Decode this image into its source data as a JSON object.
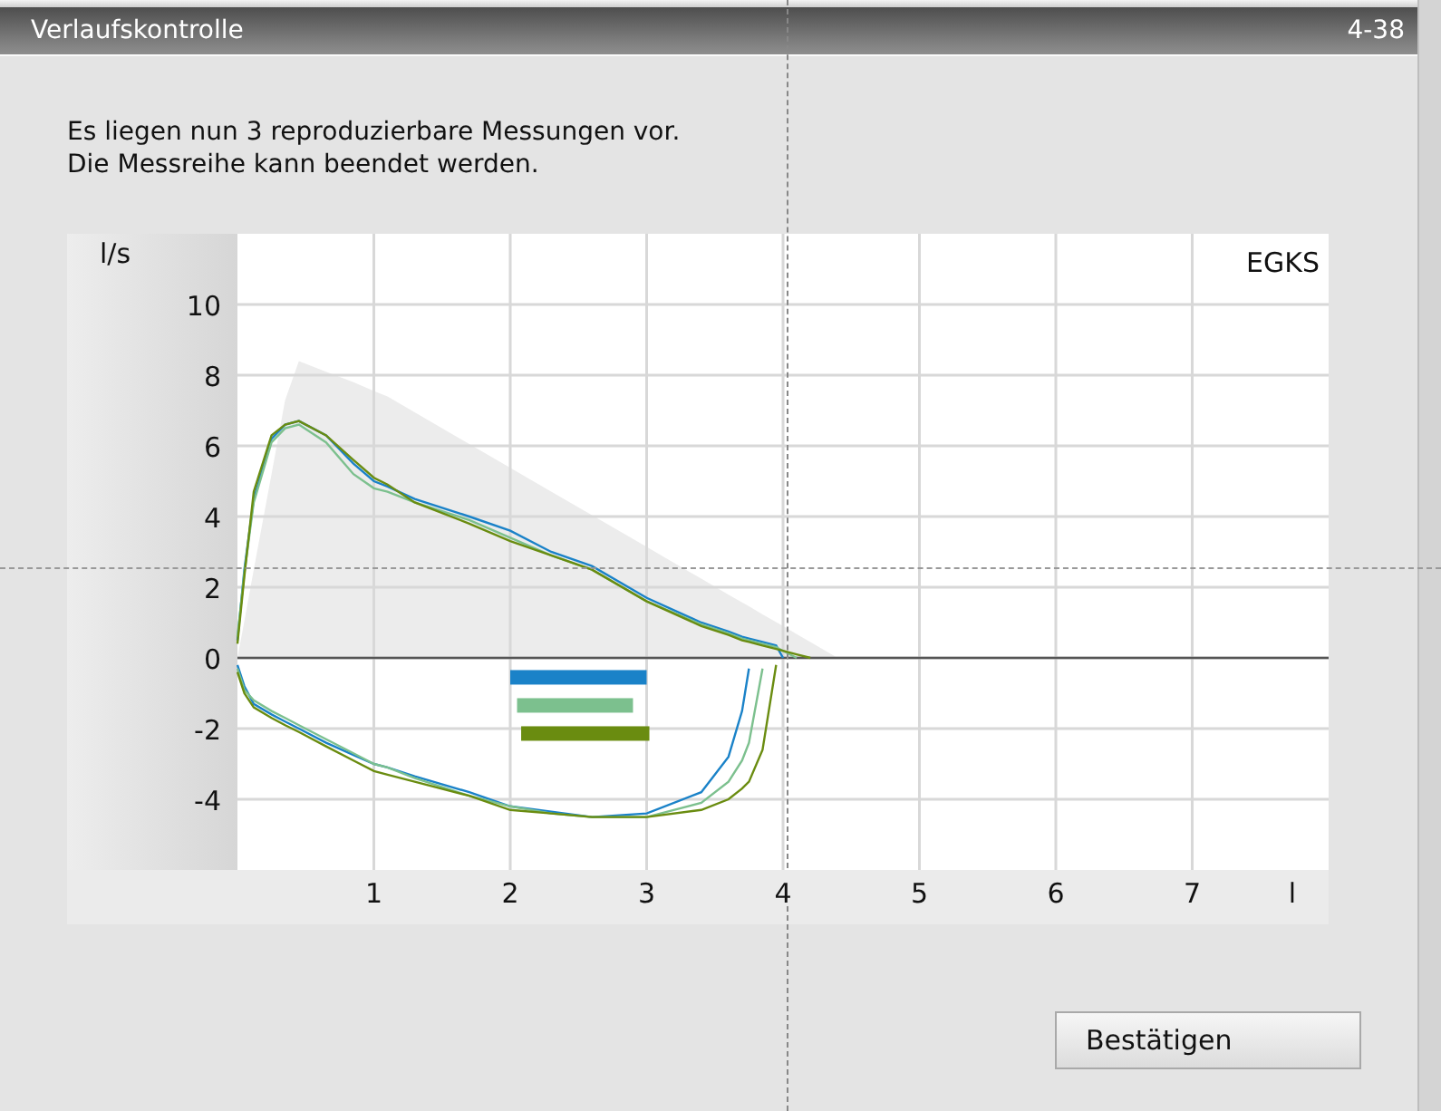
{
  "window": {
    "title": "Verlaufskontrolle",
    "code": "4-38"
  },
  "message": [
    "Es liegen nun 3 reproduzierbare Messungen vor.",
    "Die Messreihe kann beendet werden."
  ],
  "chart": {
    "chart_data": {
      "type": "line",
      "title": "EGKS",
      "xlabel": "l",
      "ylabel": "l/s",
      "xlim": [
        0,
        8
      ],
      "ylim": [
        -6,
        12
      ],
      "xticks": [
        1,
        2,
        3,
        4,
        5,
        6,
        7
      ],
      "yticks": [
        -4,
        -2,
        0,
        2,
        4,
        6,
        8,
        10
      ],
      "x": [
        0,
        0.05,
        0.12,
        0.25,
        0.35,
        0.45,
        0.65,
        0.85,
        1.0,
        1.1,
        1.3,
        1.7,
        2.0,
        2.3,
        2.6,
        3.0,
        3.4,
        3.6,
        3.7,
        3.75,
        3.85,
        3.95,
        4.0,
        4.1,
        4.2,
        4.4
      ],
      "series": [
        {
          "type": "area",
          "color": "#ececec",
          "values": [
            0,
            1.04,
            2.5,
            5.2,
            7.3,
            8.4,
            8.1,
            7.8,
            7.55,
            7.4,
            6.95,
            6.05,
            5.38,
            4.71,
            4.04,
            3.14,
            2.24,
            1.79,
            1.57,
            1.46,
            1.23,
            1.01,
            0.9,
            0.67,
            0.45,
            0
          ]
        },
        {
          "type": "line",
          "color": "#1a82c8",
          "values": [
            0.5,
            2.5,
            4.5,
            6.2,
            6.6,
            6.7,
            6.3,
            5.5,
            5.0,
            4.85,
            4.5,
            4.0,
            3.6,
            3.0,
            2.6,
            1.7,
            1.0,
            0.75,
            0.6,
            0.55,
            0.45,
            0.35,
            0,
            null,
            null,
            null
          ]
        },
        {
          "type": "line",
          "color": "#1a82c8",
          "values": [
            -0.2,
            -0.8,
            -1.3,
            -1.6,
            -1.8,
            -2.0,
            -2.4,
            -2.75,
            -3.0,
            -3.1,
            -3.35,
            -3.8,
            -4.2,
            -4.35,
            -4.5,
            -4.4,
            -3.8,
            -2.8,
            -1.5,
            -0.3,
            null,
            null,
            null,
            null,
            null,
            null
          ]
        },
        {
          "type": "line",
          "color": "#7cc08e",
          "values": [
            0.6,
            2.4,
            4.4,
            6.1,
            6.5,
            6.6,
            6.1,
            5.2,
            4.8,
            4.7,
            4.4,
            3.9,
            3.4,
            2.9,
            2.5,
            1.6,
            0.95,
            0.7,
            0.55,
            0.5,
            0.4,
            0.3,
            0.2,
            0,
            null,
            null
          ]
        },
        {
          "type": "line",
          "color": "#7cc08e",
          "values": [
            -0.3,
            -0.9,
            -1.2,
            -1.5,
            -1.7,
            -1.9,
            -2.3,
            -2.7,
            -3.0,
            -3.1,
            -3.4,
            -3.9,
            -4.2,
            -4.4,
            -4.5,
            -4.5,
            -4.1,
            -3.5,
            -2.9,
            -2.4,
            -0.3,
            null,
            null,
            null,
            null,
            null
          ]
        },
        {
          "type": "line",
          "color": "#6a8c10",
          "values": [
            0.4,
            2.3,
            4.7,
            6.3,
            6.6,
            6.7,
            6.3,
            5.6,
            5.1,
            4.9,
            4.4,
            3.8,
            3.3,
            2.9,
            2.5,
            1.6,
            0.9,
            0.65,
            0.5,
            0.45,
            0.35,
            0.25,
            0.2,
            0.1,
            0,
            null
          ]
        },
        {
          "type": "line",
          "color": "#6a8c10",
          "values": [
            -0.4,
            -1.0,
            -1.4,
            -1.7,
            -1.9,
            -2.1,
            -2.5,
            -2.9,
            -3.2,
            -3.3,
            -3.5,
            -3.9,
            -4.3,
            -4.4,
            -4.5,
            -4.5,
            -4.3,
            -4.0,
            -3.7,
            -3.5,
            -2.6,
            -0.2,
            null,
            null,
            null,
            null
          ]
        }
      ],
      "grid": true
    }
  },
  "buttons": [
    {
      "label": "Bestätigen"
    }
  ]
}
